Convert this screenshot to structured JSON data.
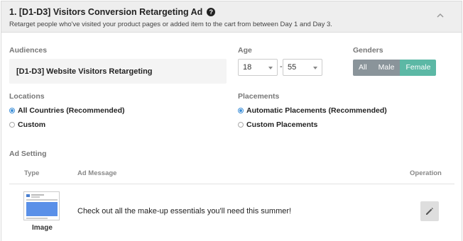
{
  "header": {
    "title": "1. [D1-D3] Visitors Conversion Retargeting Ad",
    "help_icon_glyph": "?",
    "subtitle": "Retarget people who've visited your product pages or added item to the cart from between Day 1 and Day 3."
  },
  "audiences": {
    "label": "Audiences",
    "value": "[D1-D3] Website Visitors Retargeting"
  },
  "age": {
    "label": "Age",
    "min": "18",
    "separator": "-",
    "max": "55"
  },
  "genders": {
    "label": "Genders",
    "options": [
      {
        "label": "All",
        "selected": false
      },
      {
        "label": "Male",
        "selected": false
      },
      {
        "label": "Female",
        "selected": true
      }
    ],
    "selected_color": "#5cb8a5",
    "unselected_color": "#8a949a"
  },
  "locations": {
    "label": "Locations",
    "options": [
      {
        "label": "All Countries (Recommended)",
        "checked": true
      },
      {
        "label": "Custom",
        "checked": false
      }
    ]
  },
  "placements": {
    "label": "Placements",
    "options": [
      {
        "label": "Automatic Placements (Recommended)",
        "checked": true
      },
      {
        "label": "Custom Placements",
        "checked": false
      }
    ]
  },
  "ad_setting": {
    "label": "Ad Setting",
    "columns": [
      "Type",
      "Ad Message",
      "Operation"
    ],
    "rows": [
      {
        "type": "Image",
        "message": "Check out all the make-up essentials you'll need this summer!",
        "operation_icon": "pencil-icon"
      }
    ]
  },
  "colors": {
    "radio_accent": "#3d8fd8",
    "header_bg": "#eeeeee"
  }
}
